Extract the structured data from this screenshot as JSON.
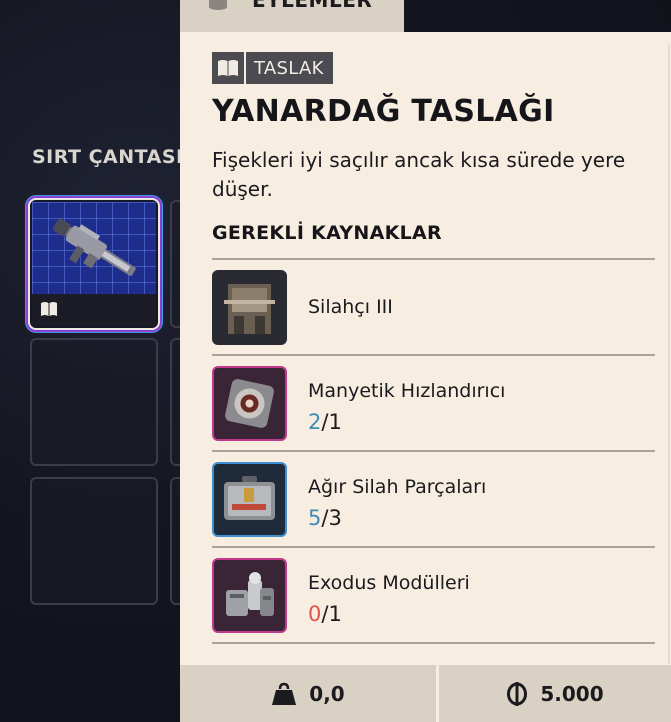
{
  "top_tab": {
    "label": "EYLEMLER",
    "icon": "cylinder-icon"
  },
  "inventory": {
    "section_label": "SIRT ÇANTASI",
    "selected_item_icon": "rifle-icon",
    "selected_item_badge_icon": "blueprint-book-icon"
  },
  "panel": {
    "badge": {
      "icon": "blueprint-book-icon",
      "label": "TASLAK"
    },
    "title": "YANARDAĞ TASLAĞI",
    "description": "Fişekleri iyi saçılır ancak kısa sürede yere düşer.",
    "requirements_heading": "GEREKLİ KAYNAKLAR",
    "requirements": [
      {
        "name": "Silahçı III",
        "icon": "workbench-icon"
      },
      {
        "name": "Manyetik Hızlandırıcı",
        "have": "2",
        "sep": "/",
        "need": "1",
        "have_color": "#3f8db5",
        "accent": "#c23a8c"
      },
      {
        "name": "Ağır Silah Parçaları",
        "have": "5",
        "sep": "/",
        "need": "3",
        "have_color": "#3f8db5",
        "accent": "#3d8fd1"
      },
      {
        "name": "Exodus Modülleri",
        "have": "0",
        "sep": "/",
        "need": "1",
        "have_color": "#e0574a",
        "accent": "#c23a8c"
      }
    ]
  },
  "footer": {
    "weight_icon": "weight-icon",
    "weight": "0,0",
    "money_icon": "coin-icon",
    "money": "5.000"
  }
}
